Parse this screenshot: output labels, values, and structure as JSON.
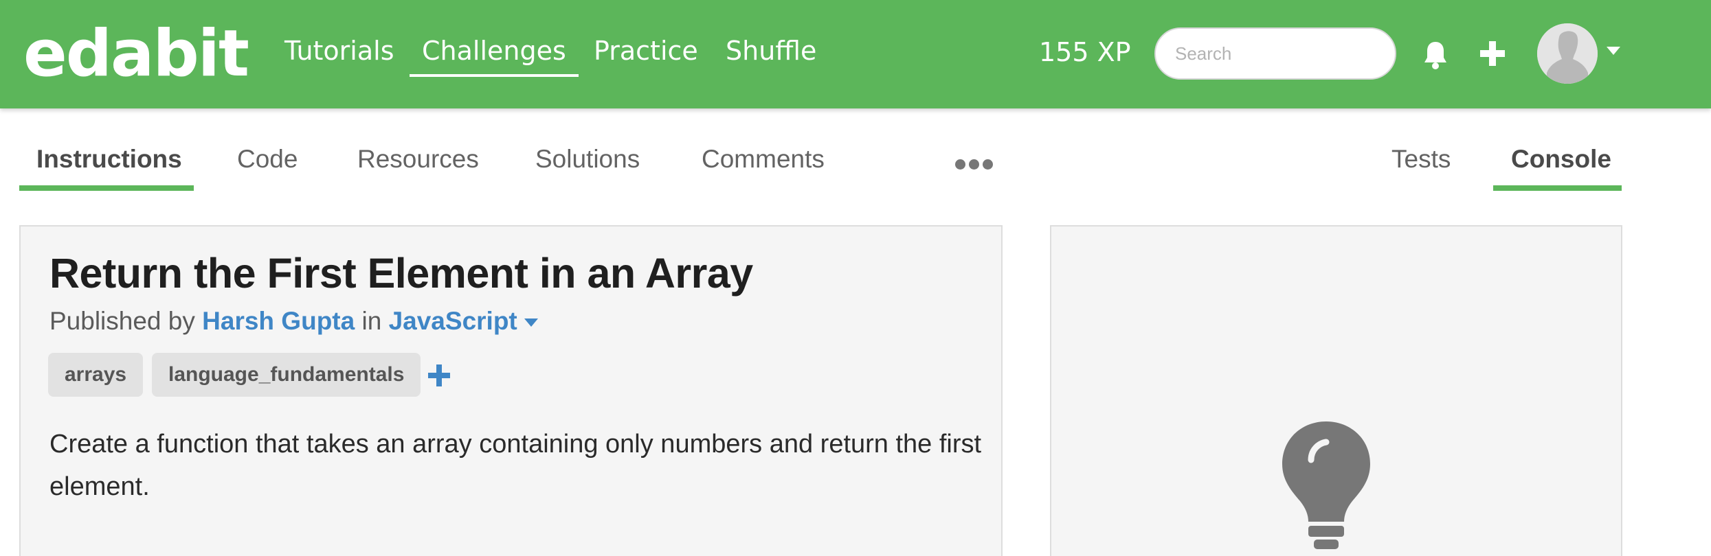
{
  "header": {
    "logo": "edabit",
    "nav": [
      "Tutorials",
      "Challenges",
      "Practice",
      "Shuffle"
    ],
    "active_nav": "Challenges",
    "xp": "155 XP",
    "search_placeholder": "Search",
    "icons": [
      "bell-icon",
      "plus-icon",
      "avatar",
      "chevron-down-icon"
    ]
  },
  "tabs": {
    "left": [
      "Instructions",
      "Code",
      "Resources",
      "Solutions",
      "Comments"
    ],
    "right": [
      "Tests",
      "Console"
    ],
    "active_left": "Instructions",
    "active_right": "Console",
    "more_icon": "more-dots-icon"
  },
  "challenge": {
    "title": "Return the First Element in an Array",
    "published_prefix": "Published by",
    "author": "Harsh Gupta",
    "in_word": "in",
    "language": "JavaScript",
    "tags": [
      "arrays",
      "language_fundamentals"
    ],
    "description": "Create a function that takes an array containing only numbers and return the first element."
  },
  "console": {
    "icon": "lightbulb-icon"
  },
  "colors": {
    "brand_green": "#5cb65a",
    "link_blue": "#3f86c6",
    "panel_bg": "#f5f5f5"
  }
}
